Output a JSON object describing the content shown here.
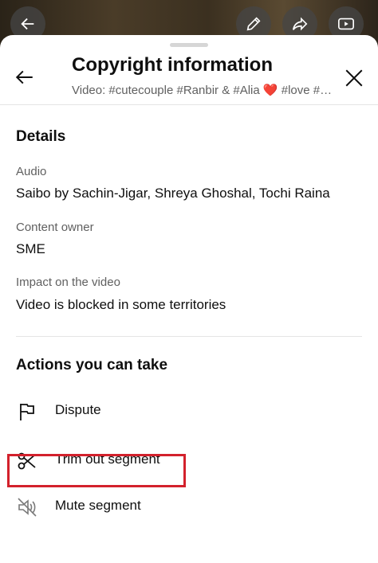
{
  "header": {
    "title": "Copyright information",
    "subtitle": "Video: #cutecouple #Ranbir & #Alia ❤️ #love #sh..."
  },
  "details": {
    "heading": "Details",
    "audio_label": "Audio",
    "audio_value": "Saibo by Sachin-Jigar, Shreya Ghoshal, Tochi Raina",
    "owner_label": "Content owner",
    "owner_value": "SME",
    "impact_label": "Impact on the video",
    "impact_value": "Video is blocked in some territories"
  },
  "actions": {
    "heading": "Actions you can take",
    "items": [
      {
        "label": "Dispute",
        "icon": "flag-icon"
      },
      {
        "label": "Trim out segment",
        "icon": "scissors-icon"
      },
      {
        "label": "Mute segment",
        "icon": "mute-icon"
      }
    ]
  },
  "colors": {
    "highlight": "#d3212c",
    "text_primary": "#0f0f0f",
    "text_secondary": "#606060"
  }
}
